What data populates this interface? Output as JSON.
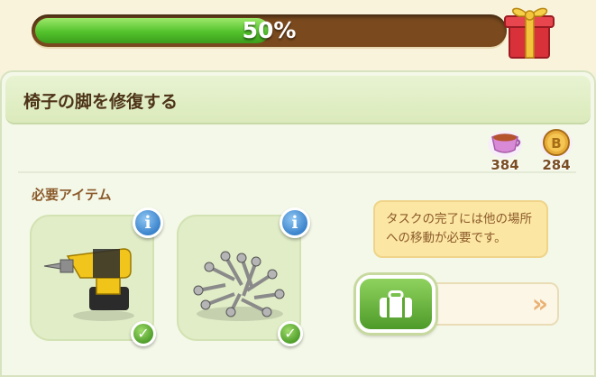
{
  "progress": {
    "percent": 0.5,
    "label": "50%"
  },
  "panel": {
    "title": "椅子の脚を修復する"
  },
  "resources": [
    {
      "name": "cup",
      "icon": "tea-cup-icon",
      "value": "384"
    },
    {
      "name": "coin",
      "icon": "coin-icon",
      "value": "284"
    }
  ],
  "requirements": {
    "label": "必要アイテム",
    "items": [
      {
        "name": "drill",
        "icon": "power-drill-icon",
        "completed": true
      },
      {
        "name": "screws",
        "icon": "screws-icon",
        "completed": true
      }
    ]
  },
  "hint": {
    "text": "タスクの完了には他の場所への移動が必要です。"
  },
  "move": {
    "icon": "suitcase-icon",
    "arrows": "»",
    "accent": "#eab173"
  },
  "colors": {
    "progress_fill": "#53c22c",
    "progress_track": "#7a4a1e",
    "panel_header": "#dbeabb",
    "title_text": "#4d3419"
  }
}
